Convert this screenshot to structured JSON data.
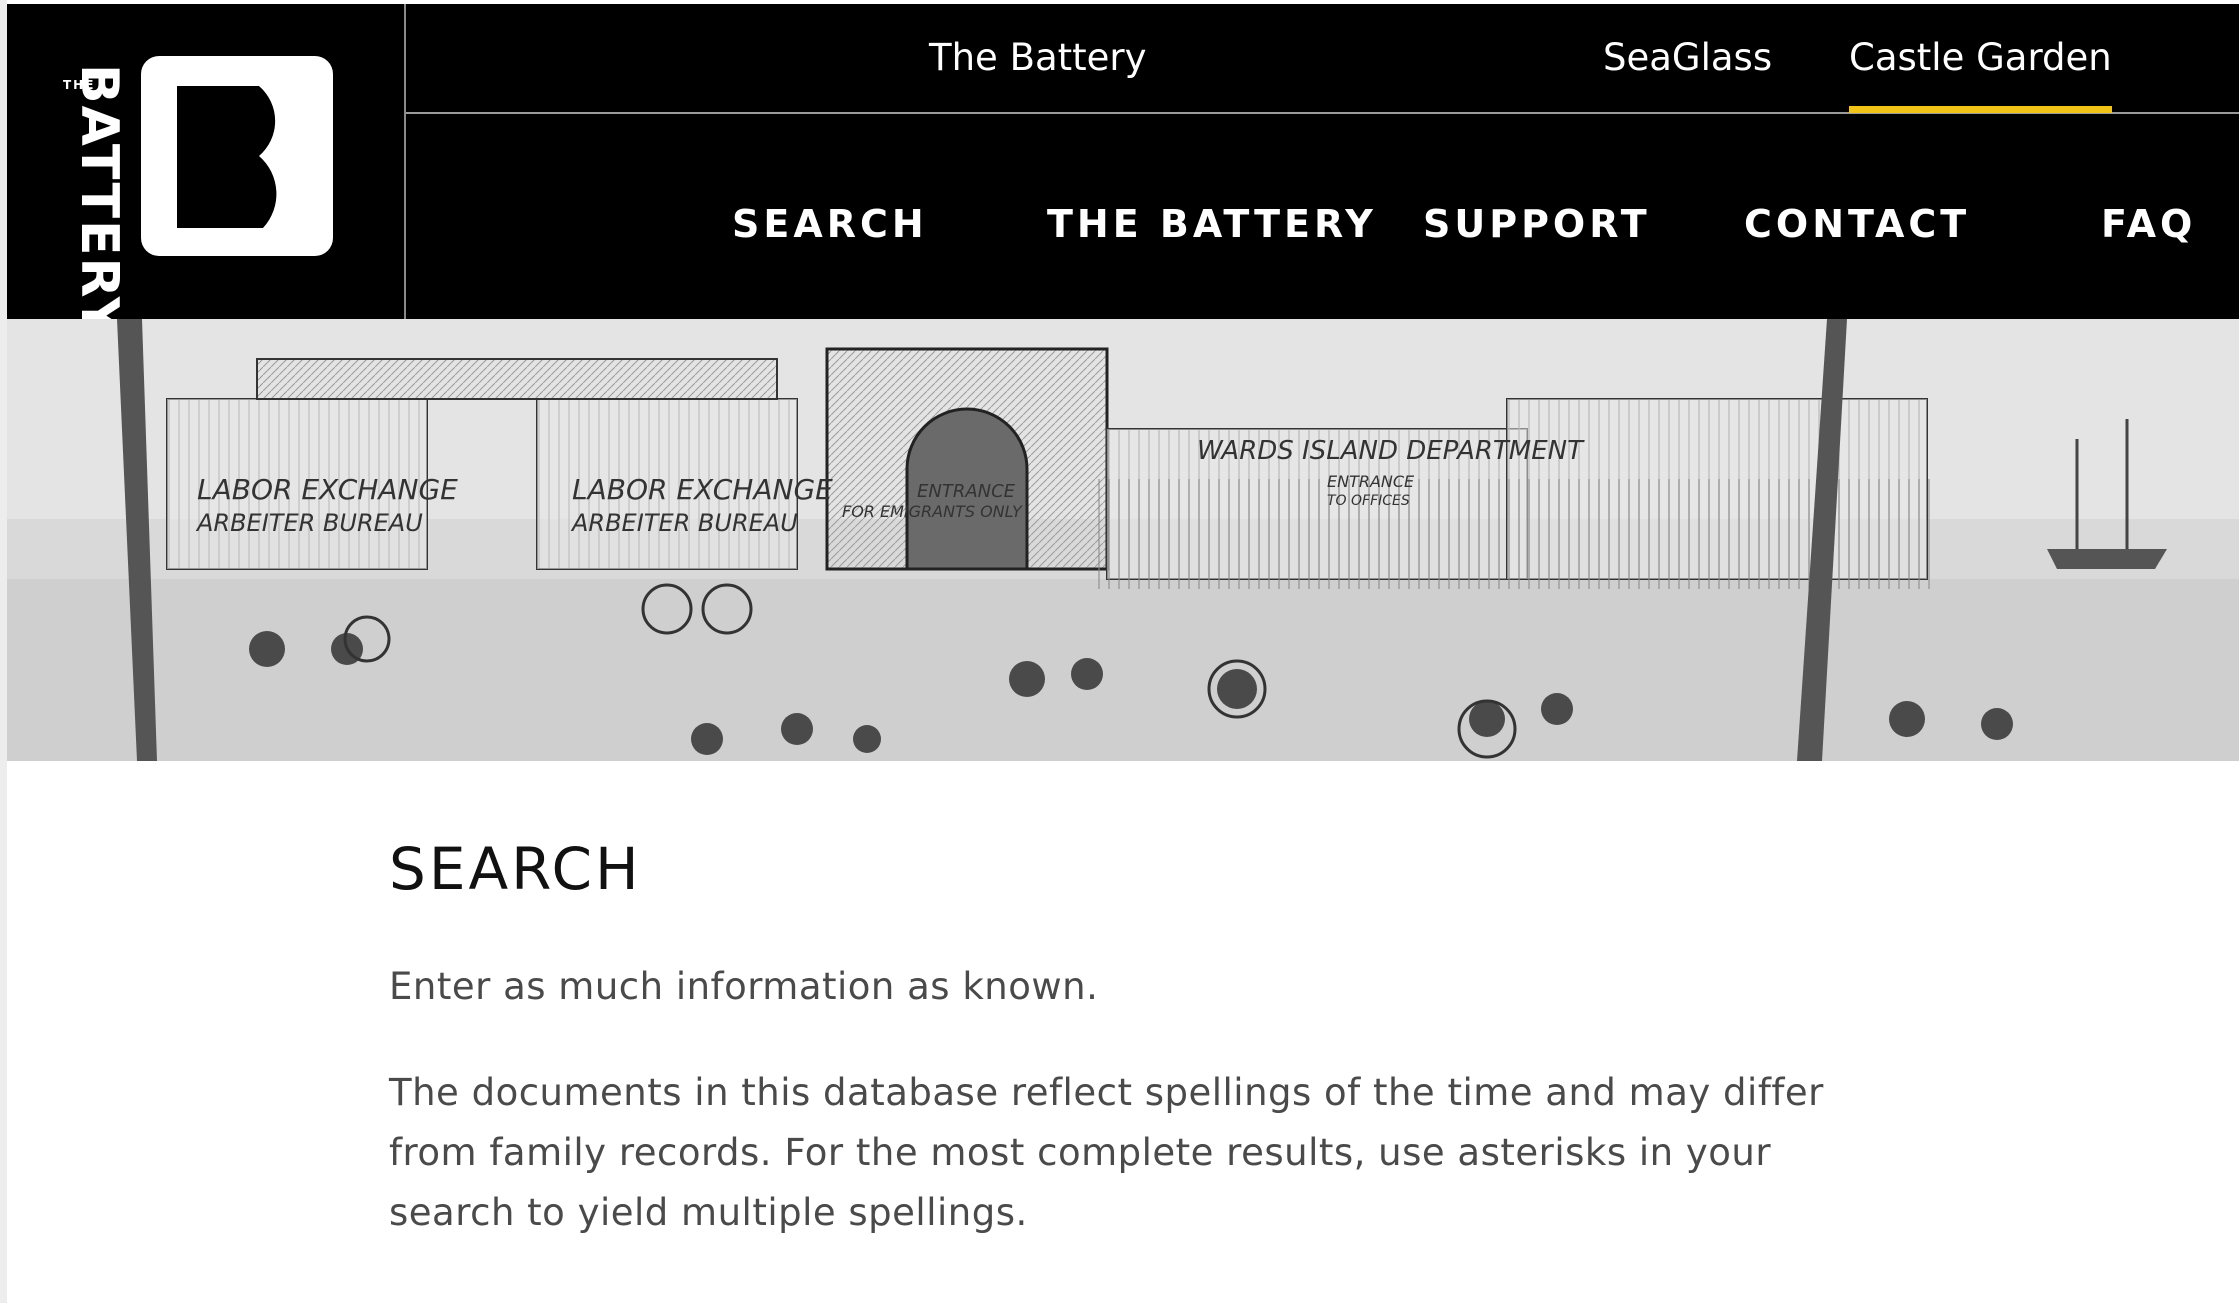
{
  "brand": {
    "logo_small": "THE",
    "logo_word": "BATTERY",
    "logo_letter": "B"
  },
  "top_nav": [
    {
      "label": "The Battery",
      "active": false
    },
    {
      "label": "SeaGlass",
      "active": false
    },
    {
      "label": "Castle Garden",
      "active": true
    }
  ],
  "main_nav": [
    {
      "label": "SEARCH"
    },
    {
      "label": "THE BATTERY"
    },
    {
      "label": "SUPPORT"
    },
    {
      "label": "CONTACT"
    },
    {
      "label": "FAQ"
    }
  ],
  "hero": {
    "signs": [
      "LABOR EXCHANGE",
      "ARBEITER BUREAU",
      "LABOR EXCHANGE",
      "ARBEITER BUREAU",
      "ENTRANCE",
      "FOR EMIGRANTS ONLY",
      "WARDS ISLAND DEPARTMENT",
      "ENTRANCE",
      "TO OFFICES"
    ]
  },
  "main": {
    "title": "SEARCH",
    "intro": "Enter as much information as known.",
    "description": "The documents in this database reflect spellings of the time and may differ from family records. For the most complete results, use asterisks in your search to yield multiple spellings."
  },
  "colors": {
    "header_bg": "#000000",
    "accent": "#f2c418",
    "text": "#4a4a4a"
  }
}
